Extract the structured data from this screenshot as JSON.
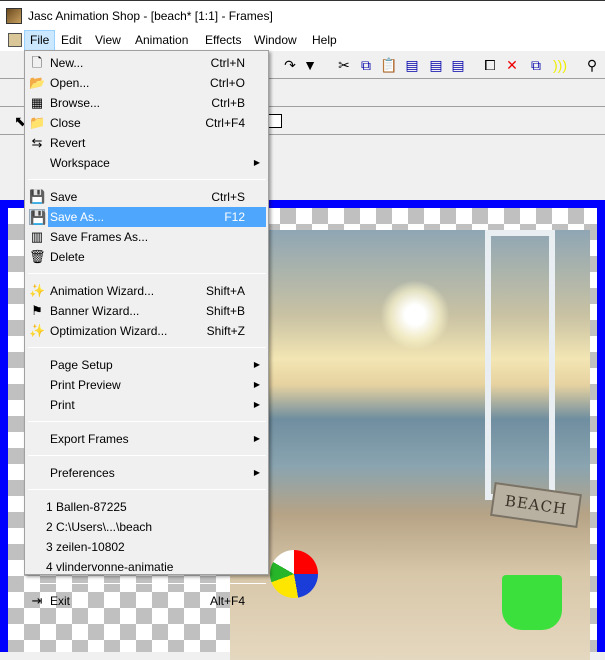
{
  "window": {
    "title": "Jasc Animation Shop - [beach* [1:1] - Frames]"
  },
  "menubar": [
    "File",
    "Edit",
    "View",
    "Animation",
    "Effects",
    "Window",
    "Help"
  ],
  "file_menu": [
    {
      "label": "New...",
      "shortcut": "Ctrl+N",
      "icon": "new-document-icon",
      "glyph": "🗋"
    },
    {
      "label": "Open...",
      "shortcut": "Ctrl+O",
      "icon": "open-folder-icon",
      "glyph": "📂"
    },
    {
      "label": "Browse...",
      "shortcut": "Ctrl+B",
      "icon": "browse-icon",
      "glyph": "▦"
    },
    {
      "label": "Close",
      "shortcut": "Ctrl+F4",
      "icon": "close-folder-icon",
      "glyph": "📁"
    },
    {
      "label": "Revert",
      "shortcut": "",
      "icon": "revert-icon",
      "glyph": "⇆"
    },
    {
      "label": "Workspace",
      "shortcut": "",
      "submenu": true
    },
    {
      "sep": true
    },
    {
      "label": "Save",
      "shortcut": "Ctrl+S",
      "icon": "save-icon",
      "glyph": "💾"
    },
    {
      "label": "Save As...",
      "shortcut": "F12",
      "icon": "save-as-icon",
      "glyph": "💾",
      "highlighted": true
    },
    {
      "label": "Save Frames As...",
      "shortcut": "",
      "icon": "save-frames-icon",
      "glyph": "▥"
    },
    {
      "label": "Delete",
      "shortcut": "",
      "icon": "trash-icon",
      "glyph": "🗑"
    },
    {
      "sep": true
    },
    {
      "label": "Animation Wizard...",
      "shortcut": "Shift+A",
      "icon": "wand-icon",
      "glyph": "✨"
    },
    {
      "label": "Banner Wizard...",
      "shortcut": "Shift+B",
      "icon": "banner-icon",
      "glyph": "⚑"
    },
    {
      "label": "Optimization Wizard...",
      "shortcut": "Shift+Z",
      "icon": "wand-icon",
      "glyph": "✨"
    },
    {
      "sep": true
    },
    {
      "label": "Page Setup",
      "shortcut": "",
      "submenu": true
    },
    {
      "label": "Print Preview",
      "shortcut": "",
      "submenu": true
    },
    {
      "label": "Print",
      "shortcut": "",
      "submenu": true
    },
    {
      "sep": true
    },
    {
      "label": "Export Frames",
      "shortcut": "",
      "submenu": true
    },
    {
      "sep": true
    },
    {
      "label": "Preferences",
      "shortcut": "",
      "submenu": true
    },
    {
      "sep": true
    },
    {
      "label": "1 Ballen-87225",
      "mru": true
    },
    {
      "label": "2 C:\\Users\\...\\beach",
      "mru": true
    },
    {
      "label": "3 zeilen-10802",
      "mru": true
    },
    {
      "label": "4 vlindervonne-animatie",
      "mru": true
    },
    {
      "sep": true
    },
    {
      "label": "Exit",
      "shortcut": "Alt+F4",
      "icon": "exit-icon",
      "glyph": "⇥"
    }
  ],
  "canvas": {
    "sign_text": "BEACH"
  },
  "colors": {
    "frame_border": "#0000ff",
    "highlight": "#3399ff"
  }
}
